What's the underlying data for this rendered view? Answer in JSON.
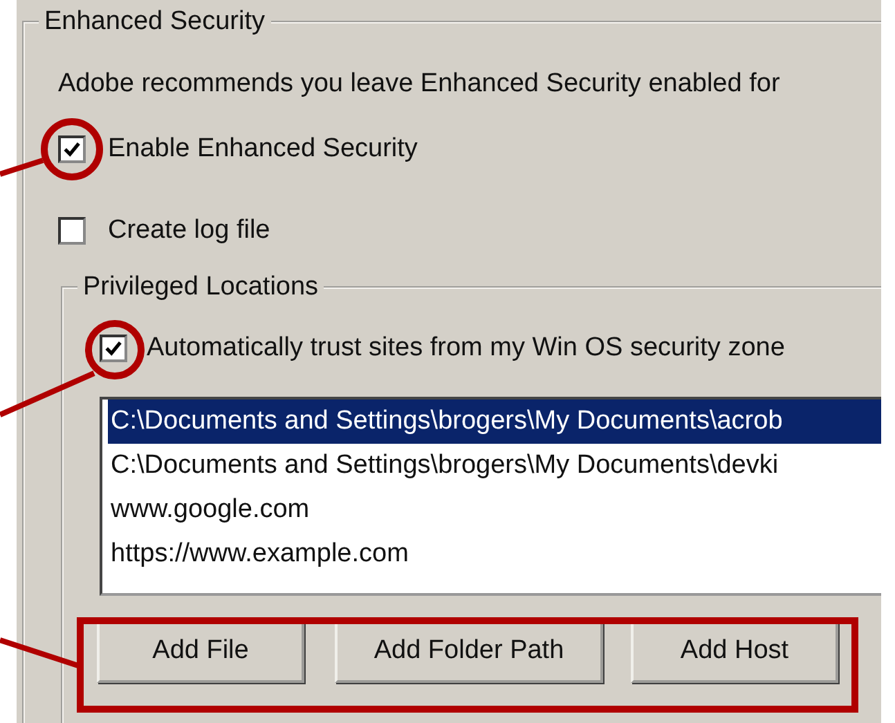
{
  "group": {
    "title": "Enhanced Security"
  },
  "note": "Adobe recommends you leave Enhanced Security enabled for",
  "options": [
    {
      "label": "Enable Enhanced Security",
      "checked": true
    },
    {
      "label": "Create log file",
      "checked": false
    }
  ],
  "privileged_locations": {
    "title": "Privileged Locations",
    "trust_option": {
      "label": "Automatically trust sites from my Win OS security zone",
      "checked": true
    },
    "locations": [
      {
        "text": "C:\\Documents and Settings\\brogers\\My Documents\\acrob",
        "selected": true
      },
      {
        "text": "C:\\Documents and Settings\\brogers\\My Documents\\devki",
        "selected": false
      },
      {
        "text": "www.google.com",
        "selected": false
      },
      {
        "text": "https://www.example.com",
        "selected": false
      }
    ],
    "buttons": [
      "Add File",
      "Add Folder Path",
      "Add Host"
    ]
  }
}
